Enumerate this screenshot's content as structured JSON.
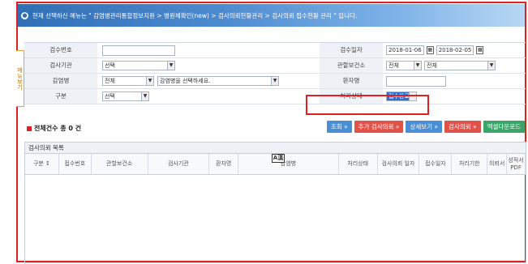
{
  "breadcrumb": {
    "icon": "info-icon",
    "text": "현재 선택하신 메뉴는 \" 감염병관리통합정보지원 > 병원체확인(new) > 검사의뢰현황관리 > 검사의뢰 접수현황 관리 \" 입니다."
  },
  "side_tab": {
    "label": "메뉴보기"
  },
  "search_form": {
    "receipt_no": {
      "label": "검수번호",
      "value": ""
    },
    "receipt_date": {
      "label": "검수일자",
      "from": "2018-01-06",
      "to": "2018-02-05"
    },
    "test_org": {
      "label": "검사기관",
      "selected": "선택"
    },
    "health_center": {
      "label": "관할보건소",
      "selected1": "전체",
      "selected2": "전체"
    },
    "disease": {
      "label": "감염병",
      "selected": "전체",
      "disease_select": "감염병을 선택하세요."
    },
    "patient": {
      "label": "환자명",
      "value": ""
    },
    "category": {
      "label": "구분",
      "selected": "선택"
    },
    "status": {
      "label": "처리상태",
      "selected": "접수완료"
    }
  },
  "summary": {
    "total_label": "전체건수 총 0 건"
  },
  "buttons": {
    "search": "조회 »",
    "add_request": "추가 검사의뢰 »",
    "detail": "상세보기 »",
    "request": "검사의뢰 »",
    "excel": "엑셀다운로드"
  },
  "grid": {
    "title": "검사의뢰 목록",
    "columns": [
      "구분 ↕",
      "접수번호",
      "관할보건소",
      "검사기관",
      "환자명",
      "감염병",
      "처리상태",
      "검사의뢰 일자",
      "접수일자",
      "처리기한",
      "의뢰서",
      "성적서 PDF"
    ]
  },
  "ime_indicator": "A漢",
  "colors": {
    "accent": "#2f6fb8",
    "highlight": "#e02020"
  }
}
